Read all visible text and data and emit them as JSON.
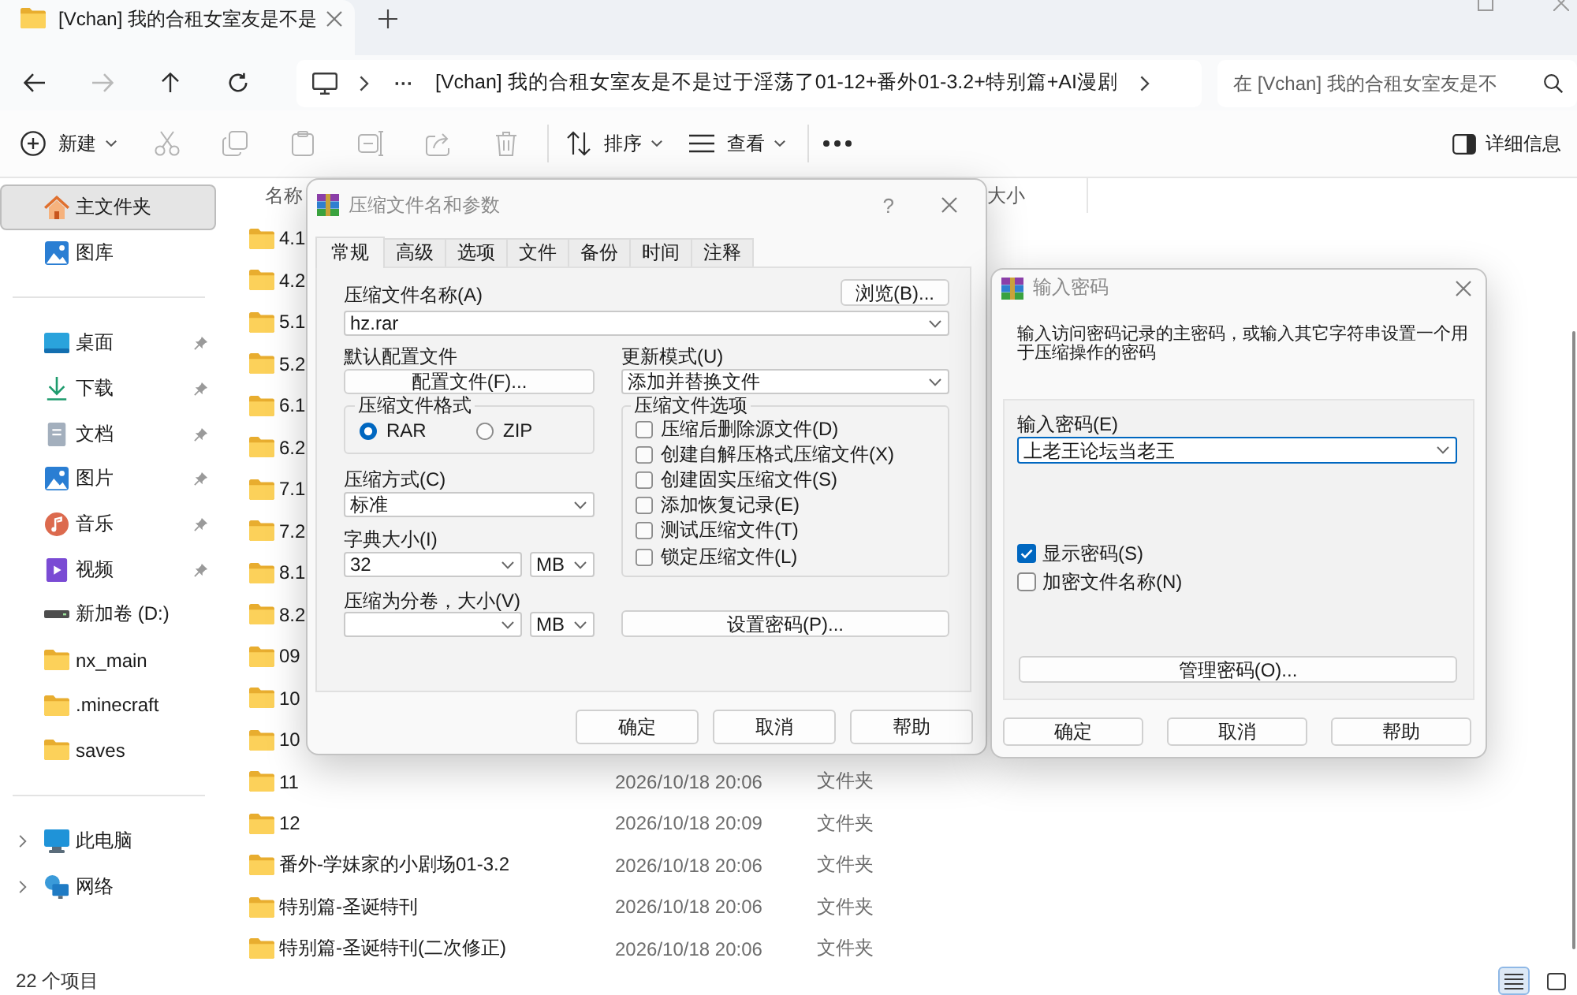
{
  "browser_tab": {
    "title": "[Vchan] 我的合租女室友是不是"
  },
  "nav_buttons": [
    {
      "kind": "back",
      "disabled": false
    },
    {
      "kind": "forward",
      "disabled": true
    },
    {
      "kind": "up",
      "disabled": false
    },
    {
      "kind": "refresh",
      "disabled": false
    }
  ],
  "address_bar": {
    "overflow": "···",
    "path": "[Vchan] 我的合租女室友是不是过于淫荡了01-12+番外01-3.2+特别篇+AI漫剧"
  },
  "search": {
    "placeholder": "在 [Vchan] 我的合租女室友是不"
  },
  "toolbar": {
    "items": [
      {
        "kind": "new",
        "label": "新建",
        "disabled": false
      },
      {
        "kind": "cut",
        "disabled": true
      },
      {
        "kind": "copy",
        "disabled": true
      },
      {
        "kind": "paste",
        "disabled": true
      },
      {
        "kind": "rename",
        "disabled": true
      },
      {
        "kind": "share",
        "disabled": true
      },
      {
        "kind": "delete",
        "disabled": true
      },
      {
        "kind": "sort",
        "label": "排序",
        "disabled": false
      },
      {
        "kind": "view",
        "label": "查看",
        "disabled": false
      },
      {
        "kind": "more",
        "disabled": false
      }
    ],
    "details_button": "详细信息"
  },
  "sidebar": {
    "sections": [
      {
        "items": [
          {
            "kind": "home",
            "label": "主文件夹",
            "selected": true,
            "pinned": false
          },
          {
            "kind": "gallery",
            "label": "图库",
            "selected": false,
            "pinned": false
          }
        ]
      },
      {
        "items": [
          {
            "kind": "desktop",
            "label": "桌面",
            "selected": false,
            "pinned": true
          },
          {
            "kind": "download",
            "label": "下载",
            "selected": false,
            "pinned": true
          },
          {
            "kind": "documents",
            "label": "文档",
            "selected": false,
            "pinned": true
          },
          {
            "kind": "pictures",
            "label": "图片",
            "selected": false,
            "pinned": true
          },
          {
            "kind": "music",
            "label": "音乐",
            "selected": false,
            "pinned": true
          },
          {
            "kind": "videos",
            "label": "视频",
            "selected": false,
            "pinned": true
          },
          {
            "kind": "drive",
            "label": "新加卷 (D:)",
            "selected": false,
            "pinned": false
          },
          {
            "kind": "folder",
            "label": "nx_main",
            "selected": false,
            "pinned": false
          },
          {
            "kind": "folder",
            "label": ".minecraft",
            "selected": false,
            "pinned": false
          },
          {
            "kind": "folder",
            "label": "saves",
            "selected": false,
            "pinned": false
          }
        ]
      },
      {
        "items": [
          {
            "kind": "pc",
            "label": "此电脑",
            "selected": false,
            "pinned": false,
            "expanded": false
          },
          {
            "kind": "network",
            "label": "网络",
            "selected": false,
            "pinned": false,
            "expanded": false
          }
        ]
      }
    ]
  },
  "file_list": {
    "columns": [
      {
        "label": "名称"
      },
      {
        "label": "大小"
      }
    ],
    "rows": [
      {
        "name": "4.1"
      },
      {
        "name": "4.2"
      },
      {
        "name": "5.1"
      },
      {
        "name": "5.2"
      },
      {
        "name": "6.1"
      },
      {
        "name": "6.2"
      },
      {
        "name": "7.1"
      },
      {
        "name": "7.2"
      },
      {
        "name": "8.1"
      },
      {
        "name": "8.2"
      },
      {
        "name": "09"
      },
      {
        "name": "10"
      },
      {
        "name": "10"
      },
      {
        "name": "11",
        "column_2": "2026/10/18 20:06",
        "column_3": "文件夹"
      },
      {
        "name": "12",
        "column_2": "2026/10/18 20:09",
        "column_3": "文件夹"
      },
      {
        "name": "番外-学妹家的小剧场01-3.2",
        "column_2": "2026/10/18 20:06",
        "column_3": "文件夹"
      },
      {
        "name": "特别篇-圣诞特刊",
        "column_2": "2026/10/18 20:06",
        "column_3": "文件夹"
      },
      {
        "name": "特别篇-圣诞特刊(二次修正)",
        "column_2": "2026/10/18 20:06",
        "column_3": "文件夹"
      }
    ]
  },
  "status_bar": {
    "item_count": "22 个项目",
    "views": [
      {
        "kind": "details",
        "selected": true
      },
      {
        "kind": "tiles",
        "selected": false
      }
    ]
  },
  "archive_dialog": {
    "title": "压缩文件名和参数",
    "help": "?",
    "tabs": [
      {
        "label": "常规",
        "selected": true
      },
      {
        "label": "高级",
        "selected": false
      },
      {
        "label": "选项",
        "selected": false
      },
      {
        "label": "文件",
        "selected": false
      },
      {
        "label": "备份",
        "selected": false
      },
      {
        "label": "时间",
        "selected": false
      },
      {
        "label": "注释",
        "selected": false
      }
    ],
    "archive_name": {
      "label": "压缩文件名称(A)",
      "value": "hz.rar"
    },
    "browse_button": "浏览(B)...",
    "profile": {
      "label": "默认配置文件",
      "button": "配置文件(F)..."
    },
    "update_mode": {
      "label": "更新模式(U)",
      "value": "添加并替换文件"
    },
    "format": {
      "label": "压缩文件格式",
      "options": [
        {
          "label": "RAR",
          "selected": true
        },
        {
          "label": "ZIP",
          "selected": false
        }
      ]
    },
    "method": {
      "label": "压缩方式(C)",
      "value": "标准"
    },
    "dictionary": {
      "label": "字典大小(I)",
      "value": "32",
      "unit": "MB"
    },
    "volumes": {
      "label": "压缩为分卷，大小(V)",
      "unit": "MB"
    },
    "options": {
      "label": "压缩文件选项",
      "items": [
        {
          "label": "压缩后删除源文件(D)",
          "checked": false
        },
        {
          "label": "创建自解压格式压缩文件(X)",
          "checked": false
        },
        {
          "label": "创建固实压缩文件(S)",
          "checked": false
        },
        {
          "label": "添加恢复记录(E)",
          "checked": false
        },
        {
          "label": "测试压缩文件(T)",
          "checked": false
        },
        {
          "label": "锁定压缩文件(L)",
          "checked": false
        }
      ]
    },
    "password_button": "设置密码(P)...",
    "buttons": [
      "确定",
      "取消",
      "帮助"
    ]
  },
  "password_dialog": {
    "title": "输入密码",
    "description": "输入访问密码记录的主密码，或输入其它字符串设置一个用于压缩操作的密码",
    "password": {
      "label": "输入密码(E)",
      "value": "上老王论坛当老王"
    },
    "checkboxes": [
      {
        "label": "显示密码(S)",
        "checked": true
      },
      {
        "label": "加密文件名称(N)",
        "checked": false
      }
    ],
    "manage_button": "管理密码(O)...",
    "buttons": [
      "确定",
      "取消",
      "帮助"
    ]
  }
}
